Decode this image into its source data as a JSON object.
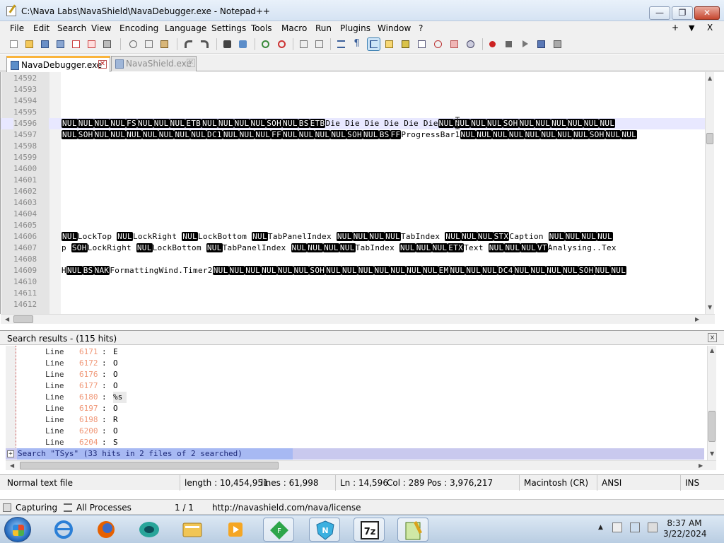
{
  "window": {
    "title": "C:\\Nava Labs\\NavaShield\\NavaDebugger.exe - Notepad++",
    "minimize_glyph": "—",
    "restore_glyph": "❐",
    "close_glyph": "✕"
  },
  "menu": {
    "items": [
      "File",
      "Edit",
      "Search",
      "View",
      "Encoding",
      "Language",
      "Settings",
      "Tools",
      "Macro",
      "Run",
      "Plugins",
      "Window",
      "?"
    ],
    "right_plus": "+",
    "right_down": "▼",
    "right_close": "X"
  },
  "toolbar": {
    "icons": [
      "new-file-icon",
      "open-file-icon",
      "save-icon",
      "save-all-icon",
      "close-icon",
      "close-all-icon",
      "print-icon",
      "cut-icon",
      "copy-icon",
      "paste-icon",
      "undo-icon",
      "redo-icon",
      "find-icon",
      "replace-icon",
      "zoom-in-icon",
      "zoom-out-icon",
      "sync-vertical-icon",
      "sync-horizontal-icon",
      "word-wrap-icon",
      "show-all-chars-icon",
      "indent-guide-icon",
      "user-language-icon",
      "doc-map-icon",
      "function-list-icon",
      "folder-workspace-icon",
      "monitoring-icon",
      "record-macro-icon",
      "stop-macro-icon",
      "play-macro-icon",
      "run-macro-multiple-icon",
      "save-macro-icon"
    ]
  },
  "tabs": [
    {
      "label": "NavaDebugger.exe",
      "active": true
    },
    {
      "label": "NavaShield.exe",
      "active": false
    }
  ],
  "editor": {
    "lines": [
      {
        "num": "14592",
        "segments": []
      },
      {
        "num": "14593",
        "segments": []
      },
      {
        "num": "14594",
        "segments": []
      },
      {
        "num": "14595",
        "segments": []
      },
      {
        "num": "14596",
        "current": true,
        "segments": [
          {
            "c": "NUL"
          },
          {
            "c": "NUL"
          },
          {
            "c": "NUL"
          },
          {
            "c": "NUL"
          },
          {
            "c": "FS"
          },
          {
            "c": "NUL"
          },
          {
            "c": "NUL"
          },
          {
            "c": "NUL"
          },
          {
            "c": "ETB"
          },
          {
            "c": "NUL"
          },
          {
            "c": "NUL"
          },
          {
            "c": "NUL"
          },
          {
            "c": "NUL"
          },
          {
            "c": "SOH"
          },
          {
            "c": "NUL"
          },
          {
            "c": "BS"
          },
          {
            "c": "ETB"
          },
          {
            "t": "Die Die Die Die Die Die"
          },
          {
            "c": "NUL"
          },
          {
            "c": "NUL"
          },
          {
            "c": "NUL"
          },
          {
            "c": "NUL"
          },
          {
            "c": "SOH"
          },
          {
            "c": "NUL"
          },
          {
            "c": "NUL"
          },
          {
            "c": "NUL"
          },
          {
            "c": "NUL"
          },
          {
            "c": "NUL"
          },
          {
            "c": "NUL"
          }
        ]
      },
      {
        "num": "14597",
        "segments": [
          {
            "c": "NUL"
          },
          {
            "c": "SOH"
          },
          {
            "c": "NUL"
          },
          {
            "c": "NUL"
          },
          {
            "c": "NUL"
          },
          {
            "c": "NUL"
          },
          {
            "c": "NUL"
          },
          {
            "c": "NUL"
          },
          {
            "c": "NUL"
          },
          {
            "c": "DC1"
          },
          {
            "c": "NUL"
          },
          {
            "c": "NUL"
          },
          {
            "c": "NUL"
          },
          {
            "c": "FF"
          },
          {
            "c": "NUL"
          },
          {
            "c": "NUL"
          },
          {
            "c": "NUL"
          },
          {
            "c": "NUL"
          },
          {
            "c": "SOH"
          },
          {
            "c": "NUL"
          },
          {
            "c": "BS"
          },
          {
            "c": "FF"
          },
          {
            "t": "ProgressBar1"
          },
          {
            "c": "NUL"
          },
          {
            "c": "NUL"
          },
          {
            "c": "NUL"
          },
          {
            "c": "NUL"
          },
          {
            "c": "NUL"
          },
          {
            "c": "NUL"
          },
          {
            "c": "NUL"
          },
          {
            "c": "NUL"
          },
          {
            "c": "SOH"
          },
          {
            "c": "NUL"
          },
          {
            "c": "NUL"
          }
        ]
      },
      {
        "num": "14598",
        "segments": []
      },
      {
        "num": "14599",
        "segments": []
      },
      {
        "num": "14600",
        "segments": []
      },
      {
        "num": "14601",
        "segments": []
      },
      {
        "num": "14602",
        "segments": []
      },
      {
        "num": "14603",
        "segments": []
      },
      {
        "num": "14604",
        "segments": []
      },
      {
        "num": "14605",
        "segments": []
      },
      {
        "num": "14606",
        "segments": [
          {
            "c": "NUL"
          },
          {
            "t": "LockTop "
          },
          {
            "c": "NUL"
          },
          {
            "t": "LockRight "
          },
          {
            "c": "NUL"
          },
          {
            "t": "LockBottom "
          },
          {
            "c": "NUL"
          },
          {
            "t": "TabPanelIndex "
          },
          {
            "c": "NUL"
          },
          {
            "c": "NUL"
          },
          {
            "c": "NUL"
          },
          {
            "c": "NUL"
          },
          {
            "t": "TabIndex "
          },
          {
            "c": "NUL"
          },
          {
            "c": "NUL"
          },
          {
            "c": "NUL"
          },
          {
            "c": "STX"
          },
          {
            "t": "Caption "
          },
          {
            "c": "NUL"
          },
          {
            "c": "NUL"
          },
          {
            "c": "NUL"
          },
          {
            "c": "NUL"
          }
        ]
      },
      {
        "num": "14607",
        "segments": [
          {
            "t": "p "
          },
          {
            "c": "SOH"
          },
          {
            "t": "LockRight "
          },
          {
            "c": "NUL"
          },
          {
            "t": "LockBottom "
          },
          {
            "c": "NUL"
          },
          {
            "t": "TabPanelIndex "
          },
          {
            "c": "NUL"
          },
          {
            "c": "NUL"
          },
          {
            "c": "NUL"
          },
          {
            "c": "NUL"
          },
          {
            "t": "TabIndex "
          },
          {
            "c": "NUL"
          },
          {
            "c": "NUL"
          },
          {
            "c": "NUL"
          },
          {
            "c": "ETX"
          },
          {
            "t": "Text "
          },
          {
            "c": "NUL"
          },
          {
            "c": "NUL"
          },
          {
            "c": "NUL"
          },
          {
            "c": "VT"
          },
          {
            "t": "Analysing..Tex"
          }
        ]
      },
      {
        "num": "14608",
        "segments": []
      },
      {
        "num": "14609",
        "segments": [
          {
            "t": "H"
          },
          {
            "c": "NUL"
          },
          {
            "c": "BS"
          },
          {
            "c": "NAK"
          },
          {
            "t": "FormattingWind.Timer2"
          },
          {
            "c": "NUL"
          },
          {
            "c": "NUL"
          },
          {
            "c": "NUL"
          },
          {
            "c": "NUL"
          },
          {
            "c": "NUL"
          },
          {
            "c": "NUL"
          },
          {
            "c": "SOH"
          },
          {
            "c": "NUL"
          },
          {
            "c": "NUL"
          },
          {
            "c": "NUL"
          },
          {
            "c": "NUL"
          },
          {
            "c": "NUL"
          },
          {
            "c": "NUL"
          },
          {
            "c": "NUL"
          },
          {
            "c": "EM"
          },
          {
            "c": "NUL"
          },
          {
            "c": "NUL"
          },
          {
            "c": "NUL"
          },
          {
            "c": "DC4"
          },
          {
            "c": "NUL"
          },
          {
            "c": "NUL"
          },
          {
            "c": "NUL"
          },
          {
            "c": "NUL"
          },
          {
            "c": "SOH"
          },
          {
            "c": "NUL"
          },
          {
            "c": "NUL"
          }
        ]
      },
      {
        "num": "14610",
        "segments": []
      },
      {
        "num": "14611",
        "segments": []
      },
      {
        "num": "14612",
        "segments": []
      }
    ]
  },
  "search_panel": {
    "title": "Search results - (115 hits)",
    "close_glyph": "x",
    "results": [
      {
        "label": "Line",
        "num": "6171",
        "value": "E"
      },
      {
        "label": "Line",
        "num": "6172",
        "value": "O"
      },
      {
        "label": "Line",
        "num": "6176",
        "value": "O"
      },
      {
        "label": "Line",
        "num": "6177",
        "value": "O"
      },
      {
        "label": "Line",
        "num": "6180",
        "value": "%s",
        "highlight": true
      },
      {
        "label": "Line",
        "num": "6197",
        "value": "O"
      },
      {
        "label": "Line",
        "num": "6198",
        "value": "R"
      },
      {
        "label": "Line",
        "num": "6200",
        "value": "O"
      },
      {
        "label": "Line",
        "num": "6204",
        "value": "S"
      }
    ],
    "summary_toggle": "+",
    "summary": "Search \"TSys\" (33 hits in 2 files of 2 searched)"
  },
  "statusbar": {
    "type": "Normal text file",
    "length": "length : 10,454,951",
    "lines": "lines : 61,998",
    "ln": "Ln : 14,596",
    "col": "Col : 289",
    "pos": "Pos : 3,976,217",
    "eol": "Macintosh (CR)",
    "encoding": "ANSI",
    "mode": "INS"
  },
  "debugger": {
    "capturing": "Capturing",
    "processes": "All Processes",
    "page": "1 / 1",
    "url": "http://navashield.com/nava/license"
  },
  "taskbar": {
    "time": "8:37 AM",
    "date": "3/22/2024",
    "apps": [
      "internet-explorer-icon",
      "firefox-icon",
      "chat-app-icon",
      "file-explorer-icon",
      "media-player-icon",
      "green-app-icon",
      "navashield-icon",
      "7zip-icon",
      "notepadpp-icon"
    ],
    "labels": {
      "7zip": "7z",
      "green": "F",
      "nava": "N"
    }
  },
  "colors": {
    "accent": "#fab43c",
    "control_char_bg": "#000000",
    "line_number": "#8a8a8a",
    "search_line_number": "#f09777",
    "summary_bg": "#c9c9ee"
  }
}
